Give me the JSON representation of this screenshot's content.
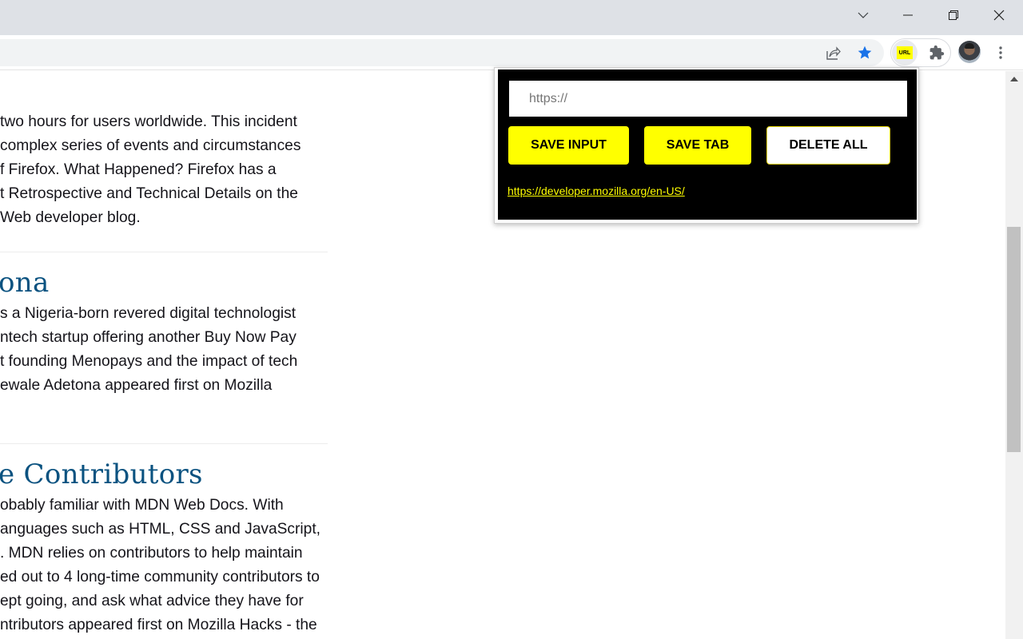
{
  "window": {
    "controls": [
      "tab-search",
      "minimize",
      "restore",
      "close"
    ]
  },
  "toolbar": {
    "icons": {
      "share": "share-icon",
      "bookmark": "star-icon",
      "extension_active": "url-extension-icon",
      "extensions": "puzzle-icon",
      "profile": "avatar",
      "menu": "kebab-menu-icon"
    },
    "extension_badge_label": "URL",
    "bookmark_color": "#1a73e8"
  },
  "article": {
    "paragraph1_lines": [
      " two hours for users worldwide. This incident",
      "complex series of events and circumstances",
      "f Firefox. What Happened? Firefox has a",
      "t Retrospective and Technical Details on the",
      "Web developer blog."
    ],
    "title2": "ona",
    "paragraph2_lines": [
      "s a Nigeria-born revered digital technologist",
      "ntech startup offering another Buy Now Pay",
      "t founding Menopays and the impact of tech",
      "ewale Adetona appeared first on Mozilla"
    ],
    "title3": "e Contributors",
    "paragraph3_lines": [
      "obably familiar with MDN Web Docs. With",
      "anguages such as HTML, CSS and JavaScript,",
      ". MDN relies on contributors to help maintain",
      "ed out to 4 long-time community contributors to",
      "ept going, and ask what advice they have for",
      "ntributors appeared first on Mozilla Hacks - the"
    ],
    "title_color": "#0a5280"
  },
  "popup": {
    "input": {
      "value": "",
      "placeholder": "https://"
    },
    "buttons": {
      "save_input": "SAVE INPUT",
      "save_tab": "SAVE TAB",
      "delete_all": "DELETE ALL"
    },
    "saved_links": [
      "https://developer.mozilla.org/en-US/"
    ],
    "accent_color": "#ffff00",
    "background_color": "#000000"
  },
  "scrollbar": {
    "position_fraction": 0.45,
    "visible_fraction": 0.42
  }
}
